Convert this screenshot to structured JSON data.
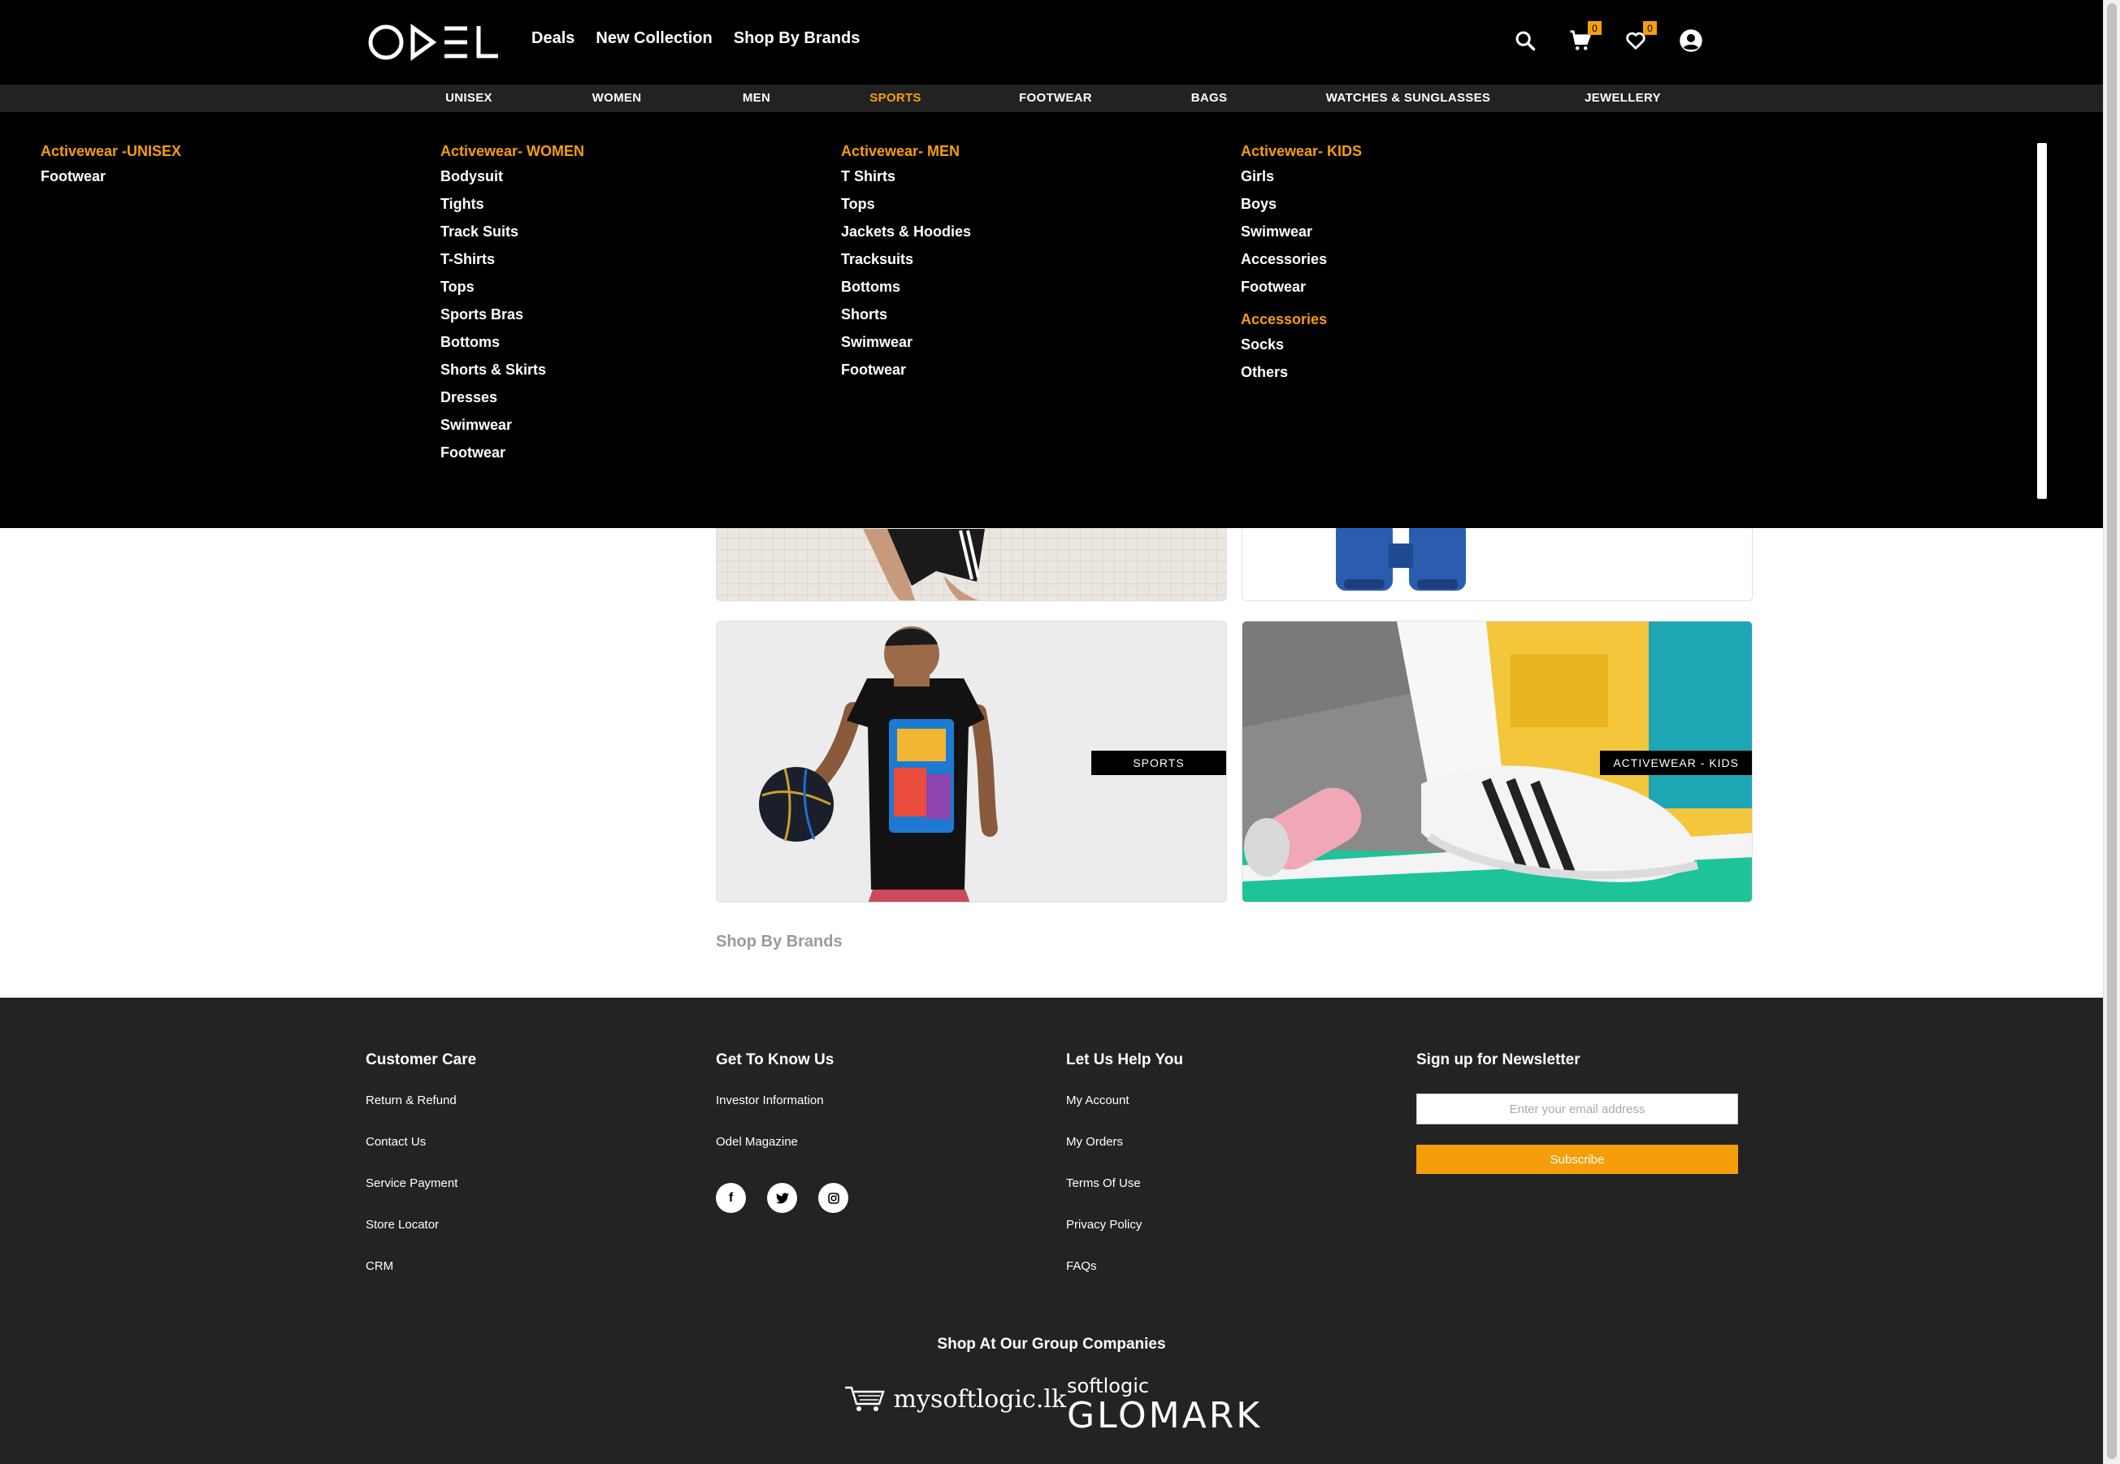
{
  "header": {
    "logo_text": "ODEL",
    "nav": [
      "Deals",
      "New Collection",
      "Shop By Brands"
    ],
    "cart_count": "0",
    "wishlist_count": "0"
  },
  "categories": [
    "UNISEX",
    "WOMEN",
    "MEN",
    "SPORTS",
    "FOOTWEAR",
    "BAGS",
    "WATCHES & SUNGLASSES",
    "JEWELLERY"
  ],
  "active_category": "SPORTS",
  "mega_menu": {
    "unisex": {
      "heading": "Activewear -UNISEX",
      "items": [
        "Footwear"
      ]
    },
    "women": {
      "heading": "Activewear- WOMEN",
      "items": [
        "Bodysuit",
        "Tights",
        "Track Suits",
        "T-Shirts",
        "Tops",
        "Sports Bras",
        "Bottoms",
        "Shorts & Skirts",
        "Dresses",
        "Swimwear",
        "Footwear"
      ]
    },
    "men": {
      "heading": "Activewear- MEN",
      "items": [
        "T Shirts",
        "Tops",
        "Jackets & Hoodies",
        "Tracksuits",
        "Bottoms",
        "Shorts",
        "Swimwear",
        "Footwear"
      ]
    },
    "kids": {
      "heading": "Activewear- KIDS",
      "items": [
        "Girls",
        "Boys",
        "Swimwear",
        "Accessories",
        "Footwear"
      ]
    },
    "accessories": {
      "heading": "Accessories",
      "items": [
        "Socks",
        "Others"
      ]
    }
  },
  "tiles": {
    "sports_label": "SPORTS",
    "kids_label": "ACTIVEWEAR - KIDS"
  },
  "shop_by_brands": "Shop By Brands",
  "footer": {
    "customer_care": {
      "heading": "Customer Care",
      "links": [
        "Return & Refund",
        "Contact Us",
        "Service Payment",
        "Store Locator",
        "CRM"
      ]
    },
    "get_to_know": {
      "heading": "Get To Know Us",
      "links": [
        "Investor Information",
        "Odel Magazine"
      ]
    },
    "help": {
      "heading": "Let Us Help You",
      "links": [
        "My Account",
        "My Orders",
        "Terms Of Use",
        "Privacy Policy",
        "FAQs"
      ]
    },
    "newsletter": {
      "heading": "Sign up for Newsletter",
      "placeholder": "Enter your email address",
      "button": "Subscribe"
    },
    "group_title": "Shop At Our Group Companies",
    "mysoftlogic": "mysoftlogic.lk",
    "glomark_top": "softlogic",
    "glomark_main": "GLOMARK"
  },
  "colors": {
    "accent": "#f59e0b",
    "header_bg": "#000000",
    "footer_bg": "#232323"
  }
}
